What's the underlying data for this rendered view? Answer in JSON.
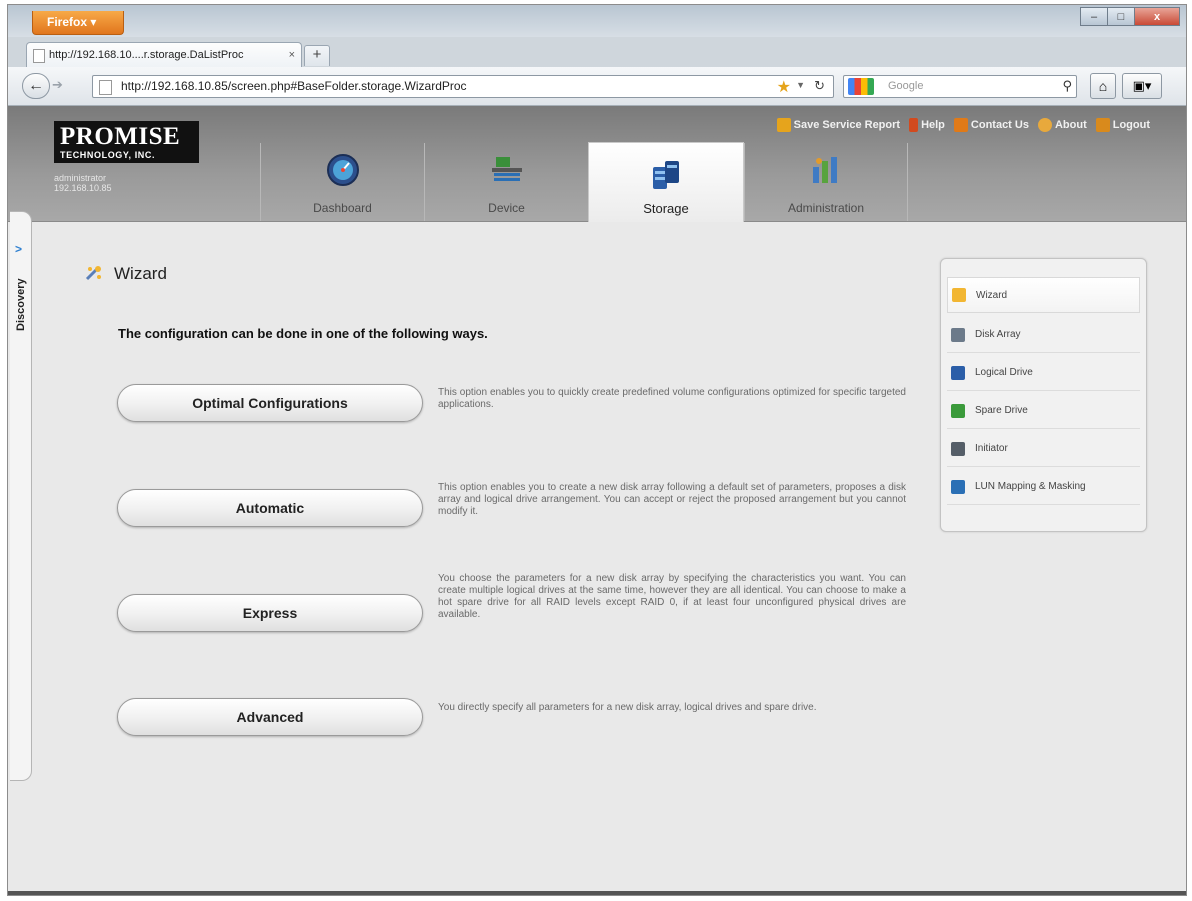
{
  "browser": {
    "menu_label": "Firefox",
    "tab_title": "http://192.168.10....r.storage.DaListProc",
    "tab_close": "×",
    "new_tab": "+",
    "url": "http://192.168.10.85/screen.php#BaseFolder.storage.WizardProc",
    "search_placeholder": "Google",
    "win_buttons": {
      "minimize": "–",
      "maximize": "□",
      "close": "x"
    }
  },
  "header": {
    "logo_main": "PROMISE",
    "logo_sub": "TECHNOLOGY, INC.",
    "user": "administrator",
    "ip": "192.168.10.85",
    "links": [
      "Save Service Report",
      "Help",
      "Contact Us",
      "About",
      "Logout"
    ],
    "tabs": [
      "Dashboard",
      "Device",
      "Storage",
      "Administration"
    ],
    "active_tab": "Storage"
  },
  "discovery": {
    "label": "Discovery",
    "arrow": ">"
  },
  "main": {
    "title": "Wizard",
    "intro": "The configuration can be done in one of the following ways.",
    "options": [
      {
        "label": "Optimal Configurations",
        "description": "This option enables you to quickly create predefined volume configurations optimized for specific targeted applications."
      },
      {
        "label": "Automatic",
        "description": "This option enables you to create a new disk array following a default set of parameters, proposes a disk array and logical drive arrangement. You can accept or reject the proposed arrangement but you cannot modify it."
      },
      {
        "label": "Express",
        "description": "You choose the parameters for a new disk array by specifying the characteristics you want. You can create multiple logical drives at the same time, however they are all identical. You can choose to make a hot spare drive for all RAID levels except RAID 0, if at least four unconfigured physical drives are available."
      },
      {
        "label": "Advanced",
        "description": "You directly specify all parameters for a new disk array, logical drives and spare drive."
      }
    ]
  },
  "side_panel": {
    "items": [
      "Wizard",
      "Disk Array",
      "Logical Drive",
      "Spare Drive",
      "Initiator",
      "LUN Mapping & Masking"
    ],
    "active": "Wizard"
  },
  "colors": {
    "firefox_orange": "#e1761d",
    "header_gray": "#8f8f8f",
    "content_bg": "#e9e9e9",
    "accent_blue": "#2d7fd0"
  }
}
